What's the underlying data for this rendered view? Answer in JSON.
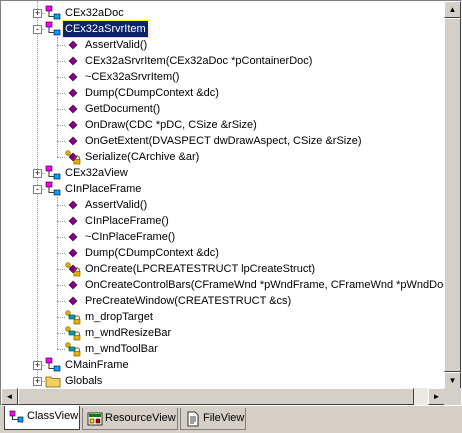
{
  "colors": {
    "selection": "#0a246a",
    "method": "#800080",
    "class_icon": "#ff00ff",
    "lock": "#d4a000"
  },
  "tree": {
    "items": [
      {
        "label": "CEx32aDoc",
        "kind": "class",
        "expander": "+"
      },
      {
        "label": "CEx32aSrvrItem",
        "kind": "class",
        "expander": "-",
        "selected": true
      },
      {
        "label": "AssertValid()",
        "kind": "method"
      },
      {
        "label": "CEx32aSrvrItem(CEx32aDoc *pContainerDoc)",
        "kind": "method"
      },
      {
        "label": "~CEx32aSrvrItem()",
        "kind": "method"
      },
      {
        "label": "Dump(CDumpContext &dc)",
        "kind": "method"
      },
      {
        "label": "GetDocument()",
        "kind": "method"
      },
      {
        "label": "OnDraw(CDC *pDC, CSize &rSize)",
        "kind": "method"
      },
      {
        "label": "OnGetExtent(DVASPECT dwDrawAspect, CSize &rSize)",
        "kind": "method"
      },
      {
        "label": "Serialize(CArchive &ar)",
        "kind": "protected-method"
      },
      {
        "label": "CEx32aView",
        "kind": "class",
        "expander": "+"
      },
      {
        "label": "CInPlaceFrame",
        "kind": "class",
        "expander": "-"
      },
      {
        "label": "AssertValid()",
        "kind": "method"
      },
      {
        "label": "CInPlaceFrame()",
        "kind": "method"
      },
      {
        "label": "~CInPlaceFrame()",
        "kind": "method"
      },
      {
        "label": "Dump(CDumpContext &dc)",
        "kind": "method"
      },
      {
        "label": "OnCreate(LPCREATESTRUCT lpCreateStruct)",
        "kind": "protected-method"
      },
      {
        "label": "OnCreateControlBars(CFrameWnd *pWndFrame, CFrameWnd *pWndDoc)",
        "kind": "method"
      },
      {
        "label": "PreCreateWindow(CREATESTRUCT &cs)",
        "kind": "method"
      },
      {
        "label": "m_dropTarget",
        "kind": "protected-member"
      },
      {
        "label": "m_wndResizeBar",
        "kind": "protected-member"
      },
      {
        "label": "m_wndToolBar",
        "kind": "protected-member"
      },
      {
        "label": "CMainFrame",
        "kind": "class",
        "expander": "+"
      },
      {
        "label": "Globals",
        "kind": "folder",
        "expander": "+"
      }
    ]
  },
  "tabs": [
    {
      "label": "ClassView",
      "icon": "classview-icon",
      "active": true
    },
    {
      "label": "ResourceView",
      "icon": "resourceview-icon"
    },
    {
      "label": "FileView",
      "icon": "fileview-icon"
    }
  ],
  "scrollbars": {
    "vertical": {
      "up": "▲",
      "down": "▼"
    },
    "horizontal": {
      "left": "◄",
      "right": "►"
    }
  }
}
